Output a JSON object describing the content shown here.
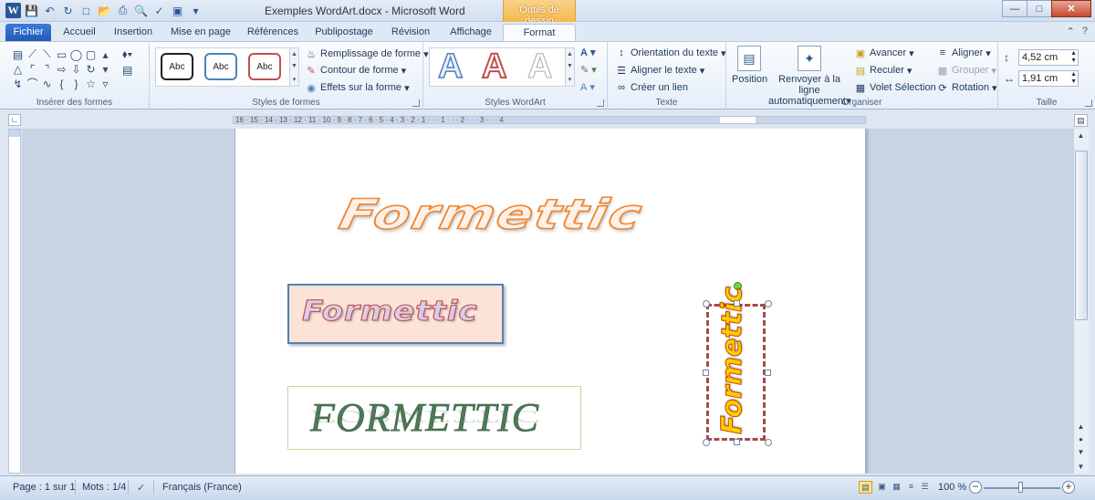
{
  "window": {
    "title": "Exemples WordArt.docx - Microsoft Word",
    "contextual_tab_group": "Outils de dessin",
    "app_icon": "W"
  },
  "tabs": [
    {
      "label": "Fichier"
    },
    {
      "label": "Accueil"
    },
    {
      "label": "Insertion"
    },
    {
      "label": "Mise en page"
    },
    {
      "label": "Références"
    },
    {
      "label": "Publipostage"
    },
    {
      "label": "Révision"
    },
    {
      "label": "Affichage"
    },
    {
      "label": "Format"
    }
  ],
  "ribbon": {
    "insert_shapes_label": "Insérer des formes",
    "shape_styles_label": "Styles de formes",
    "shape_style_samples": [
      "Abc",
      "Abc",
      "Abc"
    ],
    "fill_shape": "Remplissage de forme",
    "shape_outline": "Contour de forme",
    "shape_effects": "Effets sur la forme",
    "wordart_styles_label": "Styles WordArt",
    "wordart_letter": "A",
    "text_direction": "Orientation du texte",
    "align_text": "Aligner le texte",
    "create_link": "Créer un lien",
    "text_label": "Texte",
    "position": "Position",
    "wrap_text_1": "Renvoyer à la ligne",
    "wrap_text_2": "automatiquement",
    "bring_forward": "Avancer",
    "send_backward": "Reculer",
    "selection_pane": "Volet Sélection",
    "align": "Aligner",
    "group": "Grouper",
    "rotate": "Rotation",
    "arrange_label": "Organiser",
    "height_value": "4,52 cm",
    "width_value": "1,91 cm",
    "size_label": "Taille"
  },
  "ruler": {
    "ticks": "16 · 15 · 14 · 13 · 12 · 11 · 10 · 9 · 8 · 7 · 6 · 5 · 4 · 3 · 2 · 1 · · · 1 · · · 2 · · · 3 · · · 4"
  },
  "document": {
    "wordart_1": "Formettic",
    "wordart_2": "Formettic",
    "wordart_3": "FORMETTIC",
    "wordart_4": "Formettic"
  },
  "status": {
    "page": "Page : 1 sur 1",
    "words": "Mots : 1/4",
    "language": "Français (France)",
    "zoom": "100 %"
  },
  "colors": {
    "accent_blue": "#2b5797",
    "contextual_orange": "#f5b94e",
    "wordart_orange": "#f0852e",
    "wordart_green": "#4f7a55",
    "selection_dash": "#a54b4b"
  }
}
